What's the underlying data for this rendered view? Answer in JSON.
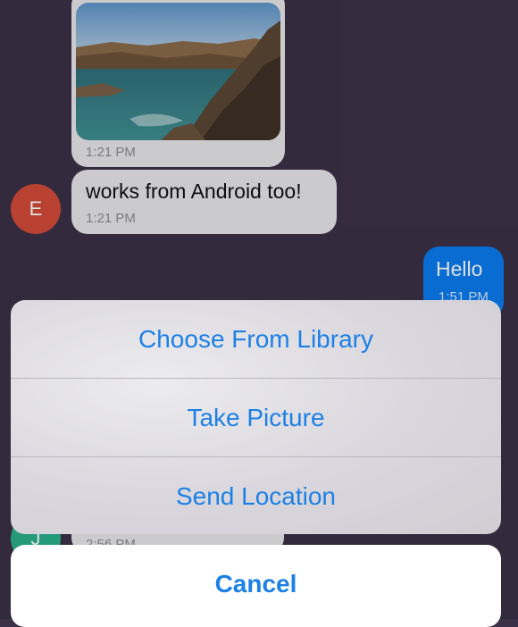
{
  "messages": {
    "photo_time": "1:21 PM",
    "android_text": "works from Android too!",
    "android_time": "1:21 PM",
    "android_avatar": "E",
    "hello_text": "Hello",
    "hello_time": "1:51 PM",
    "bottom_avatar": "J",
    "bottom_time": "2:56 PM"
  },
  "action_sheet": {
    "items": [
      "Choose From Library",
      "Take Picture",
      "Send Location"
    ],
    "cancel": "Cancel"
  },
  "colors": {
    "background": "#3c3047",
    "incoming_bubble": "#e7e6ea",
    "outgoing_bubble": "#0a7cf0",
    "avatar_e": "#d24a3a",
    "avatar_j": "#2bb08b",
    "action_text": "#1d80e5"
  },
  "icons": [
    "photo-thumbnail"
  ]
}
